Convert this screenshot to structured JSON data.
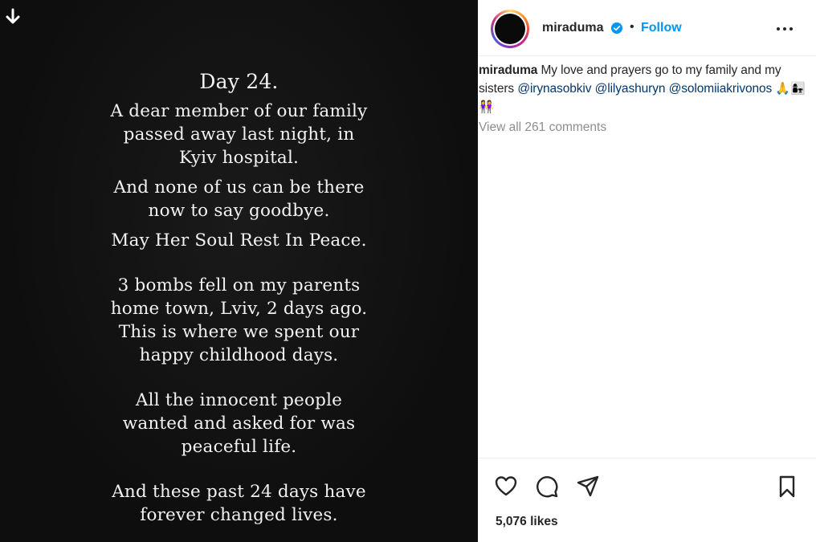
{
  "story": {
    "title": "Day 24.",
    "lines": [
      "A dear member of our family",
      "passed away last night, in",
      "Kyiv hospital.",
      "And none of us can be there",
      "now to say goodbye.",
      "May Her Soul Rest In Peace.",
      "3 bombs fell on my parents",
      "home town, Lviv, 2 days ago.",
      "This is where we spent our",
      "happy childhood days.",
      "All the innocent people",
      "wanted and asked for was",
      "peaceful life.",
      "And these past 24 days have",
      "forever changed lives."
    ]
  },
  "header": {
    "username": "miraduma",
    "dot": "•",
    "follow_label": "Follow"
  },
  "caption": {
    "username": "miraduma",
    "text": "My love and prayers go to my family and my sisters",
    "mentions": [
      "@irynasobkiv",
      "@lilyashuryn",
      "@solomiiakrivonos"
    ],
    "emojis": "🙏👩‍👧👭"
  },
  "comments": {
    "view_all": "View all 261 comments"
  },
  "likes": {
    "count_text": "5,076 likes"
  },
  "icons": {
    "download": "download-icon",
    "verified": "verified-badge-icon",
    "more": "more-options-icon",
    "like": "heart-icon",
    "comment": "comment-icon",
    "share": "share-icon",
    "save": "bookmark-icon"
  },
  "colors": {
    "follow": "#0095f6",
    "mention": "#00376b",
    "muted": "#8e8e8e",
    "verified": "#0095f6"
  }
}
